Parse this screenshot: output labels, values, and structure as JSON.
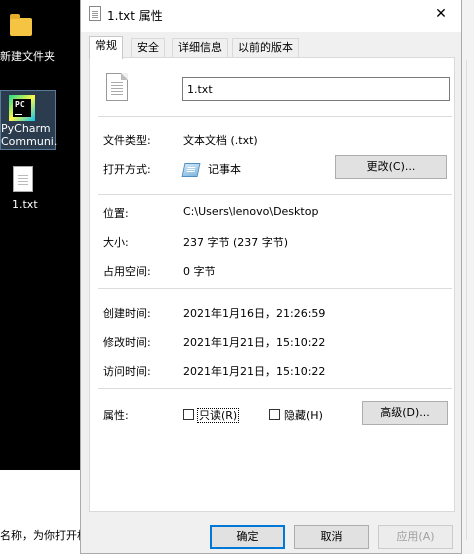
{
  "desktop": {
    "folder_label": "新建文件夹",
    "pycharm_label_1": "PyCharm",
    "pycharm_label_2": "Communi...",
    "pycharm_logo_text": "PC",
    "txt_label": "1.txt",
    "bg_fragment": "名称，为你打开相"
  },
  "dialog": {
    "title": "1.txt 属性",
    "close_glyph": "✕",
    "tabs": [
      {
        "label": "常规",
        "active": true
      },
      {
        "label": "安全",
        "active": false
      },
      {
        "label": "详细信息",
        "active": false
      },
      {
        "label": "以前的版本",
        "active": false
      }
    ],
    "filename": "1.txt",
    "rows": {
      "file_type_label": "文件类型:",
      "file_type_value": "文本文档 (.txt)",
      "open_with_label": "打开方式:",
      "open_with_value": "记事本",
      "change_button": "更改(C)...",
      "location_label": "位置:",
      "location_value": "C:\\Users\\lenovo\\Desktop",
      "size_label": "大小:",
      "size_value": "237 字节 (237 字节)",
      "disk_size_label": "占用空间:",
      "disk_size_value": "0 字节",
      "created_label": "创建时间:",
      "created_value": "2021年1月16日，21:26:59",
      "modified_label": "修改时间:",
      "modified_value": "2021年1月21日，15:10:22",
      "accessed_label": "访问时间:",
      "accessed_value": "2021年1月21日，15:10:22",
      "attributes_label": "属性:",
      "readonly_label": "只读(R)",
      "hidden_label": "隐藏(H)",
      "advanced_button": "高级(D)..."
    },
    "buttons": {
      "ok": "确定",
      "cancel": "取消",
      "apply": "应用(A)"
    }
  },
  "colors": {
    "accent": "#0078d7",
    "dialog_bg": "#f0f0f0",
    "desktop_bg": "#000000"
  }
}
